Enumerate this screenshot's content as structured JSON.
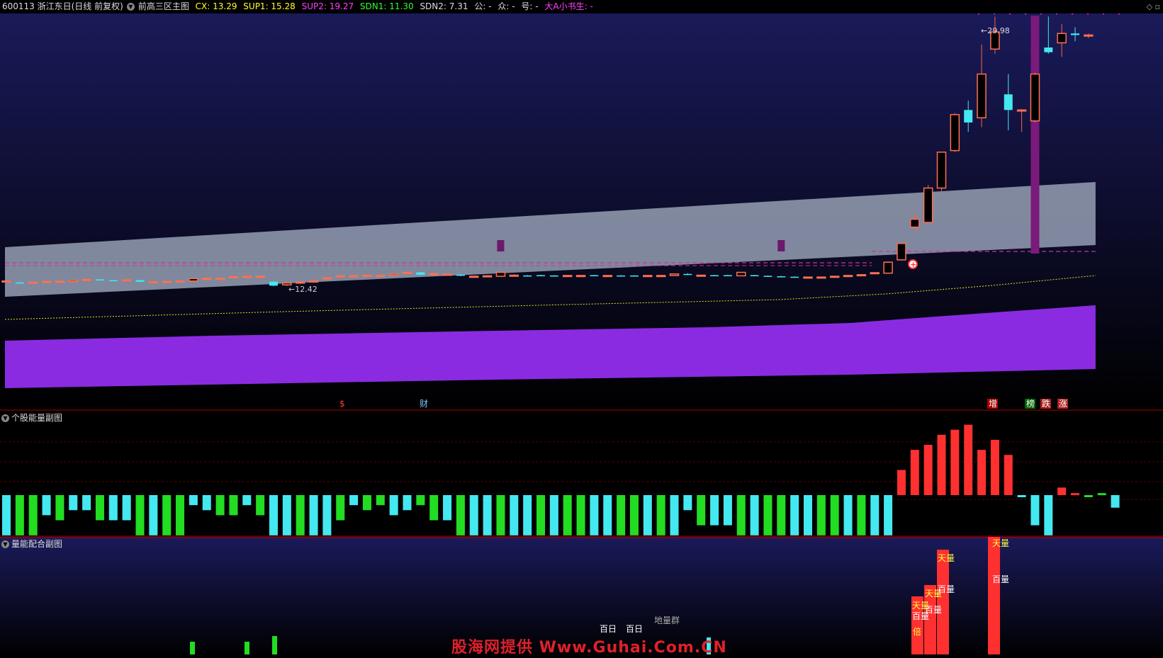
{
  "header": {
    "stock": "600113 浙江东日(日线 前复权)",
    "indicator": "前高三区主图",
    "cx": "CX: 13.29",
    "sup1": "SUP1: 15.28",
    "sup2": "SUP2: 19.27",
    "sdn1": "SDN1: 11.30",
    "sdn2": "SDN2: 7.31",
    "gong": "公: -",
    "zhong": "众: -",
    "hao": "号: -",
    "author": "大A小书生: -"
  },
  "colors": {
    "background": "#000000",
    "main_bg_top": "#1a1a5a",
    "band": "#8a94a8",
    "lower_band": "#8a2be2",
    "up": "#ff3030",
    "down": "#44e8f0",
    "green": "#22dd22",
    "magenta_line": "#cc3399",
    "yellow_dash": "#e8e020"
  },
  "main_panel": {
    "high_label": "29.98",
    "low_label": "←12.42",
    "markers": [
      "$",
      "财",
      "增",
      "榜",
      "跌",
      "涨"
    ]
  },
  "volume_panel": {
    "title": "个股能量副图"
  },
  "mix_panel": {
    "title": "量能配合副图",
    "labels": [
      "天量",
      "百量",
      "天量",
      "百量",
      "天量",
      "百量",
      "天量",
      "百量",
      "地量群",
      "百日",
      "百日",
      "倍"
    ]
  },
  "watermark": "股海网提供 Www.Guhai.Com.CN",
  "chart_data": {
    "type": "candlestick",
    "title": "600113 浙江东日(日线 前复权)",
    "candles": [
      {
        "o": 13.0,
        "c": 13.05,
        "h": 13.1,
        "l": 12.95
      },
      {
        "o": 12.95,
        "c": 12.93,
        "h": 13.0,
        "l": 12.9
      },
      {
        "o": 12.95,
        "c": 12.97,
        "h": 13.0,
        "l": 12.92
      },
      {
        "o": 13.0,
        "c": 13.02,
        "h": 13.05,
        "l": 12.98
      },
      {
        "o": 13.0,
        "c": 13.03,
        "h": 13.05,
        "l": 12.98
      },
      {
        "o": 13.0,
        "c": 13.08,
        "h": 13.1,
        "l": 12.98
      },
      {
        "o": 13.15,
        "c": 13.15,
        "h": 13.2,
        "l": 13.1
      },
      {
        "o": 13.15,
        "c": 13.12,
        "h": 13.18,
        "l": 13.1
      },
      {
        "o": 13.1,
        "c": 13.08,
        "h": 13.12,
        "l": 13.05
      },
      {
        "o": 13.1,
        "c": 13.12,
        "h": 13.15,
        "l": 13.08
      },
      {
        "o": 13.1,
        "c": 13.0,
        "h": 13.12,
        "l": 12.98
      },
      {
        "o": 13.0,
        "c": 13.0,
        "h": 13.02,
        "l": 12.95
      },
      {
        "o": 13.0,
        "c": 13.02,
        "h": 13.05,
        "l": 12.98
      },
      {
        "o": 13.05,
        "c": 13.05,
        "h": 13.07,
        "l": 13.03
      },
      {
        "o": 13.05,
        "c": 13.2,
        "h": 13.25,
        "l": 13.03
      },
      {
        "o": 13.22,
        "c": 13.22,
        "h": 13.3,
        "l": 13.15
      },
      {
        "o": 13.22,
        "c": 13.22,
        "h": 13.28,
        "l": 13.15
      },
      {
        "o": 13.3,
        "c": 13.32,
        "h": 13.38,
        "l": 13.25
      },
      {
        "o": 13.28,
        "c": 13.35,
        "h": 13.45,
        "l": 13.25
      },
      {
        "o": 13.35,
        "c": 13.35,
        "h": 13.4,
        "l": 13.28
      },
      {
        "o": 13.0,
        "c": 12.75,
        "h": 13.05,
        "l": 12.7
      },
      {
        "o": 12.8,
        "c": 12.92,
        "h": 12.95,
        "l": 12.72
      },
      {
        "o": 12.92,
        "c": 12.98,
        "h": 13.02,
        "l": 12.85
      },
      {
        "o": 12.98,
        "c": 13.05,
        "h": 13.1,
        "l": 12.92
      },
      {
        "o": 13.2,
        "c": 13.25,
        "h": 13.3,
        "l": 13.15
      },
      {
        "o": 13.35,
        "c": 13.38,
        "h": 13.42,
        "l": 13.3
      },
      {
        "o": 13.38,
        "c": 13.38,
        "h": 13.45,
        "l": 13.3
      },
      {
        "o": 13.38,
        "c": 13.42,
        "h": 13.45,
        "l": 13.33
      },
      {
        "o": 13.38,
        "c": 13.4,
        "h": 13.43,
        "l": 13.35
      },
      {
        "o": 13.42,
        "c": 13.5,
        "h": 13.53,
        "l": 13.38
      },
      {
        "o": 13.55,
        "c": 13.6,
        "h": 13.62,
        "l": 13.5
      },
      {
        "o": 13.6,
        "c": 13.45,
        "h": 13.63,
        "l": 13.43
      },
      {
        "o": 13.52,
        "c": 13.52,
        "h": 13.58,
        "l": 13.48
      },
      {
        "o": 13.48,
        "c": 13.48,
        "h": 13.5,
        "l": 13.45
      },
      {
        "o": 13.45,
        "c": 13.38,
        "h": 13.48,
        "l": 13.35
      },
      {
        "o": 13.35,
        "c": 13.35,
        "h": 13.4,
        "l": 13.3
      },
      {
        "o": 13.35,
        "c": 13.38,
        "h": 13.42,
        "l": 13.32
      },
      {
        "o": 13.35,
        "c": 13.6,
        "h": 13.62,
        "l": 13.33
      },
      {
        "o": 13.42,
        "c": 13.42,
        "h": 13.48,
        "l": 13.38
      },
      {
        "o": 13.4,
        "c": 13.38,
        "h": 13.43,
        "l": 13.35
      },
      {
        "o": 13.42,
        "c": 13.38,
        "h": 13.45,
        "l": 13.35
      },
      {
        "o": 13.4,
        "c": 13.38,
        "h": 13.43,
        "l": 13.36
      },
      {
        "o": 13.4,
        "c": 13.4,
        "h": 13.42,
        "l": 13.38
      },
      {
        "o": 13.4,
        "c": 13.4,
        "h": 13.42,
        "l": 13.38
      },
      {
        "o": 13.42,
        "c": 13.38,
        "h": 13.44,
        "l": 13.36
      },
      {
        "o": 13.4,
        "c": 13.4,
        "h": 13.42,
        "l": 13.38
      },
      {
        "o": 13.4,
        "c": 13.38,
        "h": 13.42,
        "l": 13.36
      },
      {
        "o": 13.4,
        "c": 13.38,
        "h": 13.42,
        "l": 13.36
      },
      {
        "o": 13.4,
        "c": 13.4,
        "h": 13.42,
        "l": 13.38
      },
      {
        "o": 13.4,
        "c": 13.4,
        "h": 13.42,
        "l": 13.38
      },
      {
        "o": 13.4,
        "c": 13.5,
        "h": 13.52,
        "l": 13.38
      },
      {
        "o": 13.5,
        "c": 13.45,
        "h": 13.55,
        "l": 13.43
      },
      {
        "o": 13.42,
        "c": 13.42,
        "h": 13.44,
        "l": 13.4
      },
      {
        "o": 13.42,
        "c": 13.4,
        "h": 13.44,
        "l": 13.38
      },
      {
        "o": 13.42,
        "c": 13.4,
        "h": 13.44,
        "l": 13.38
      },
      {
        "o": 13.38,
        "c": 13.6,
        "h": 13.62,
        "l": 13.36
      },
      {
        "o": 13.42,
        "c": 13.38,
        "h": 13.44,
        "l": 13.36
      },
      {
        "o": 13.38,
        "c": 13.35,
        "h": 13.4,
        "l": 13.33
      },
      {
        "o": 13.35,
        "c": 13.33,
        "h": 13.38,
        "l": 13.3
      },
      {
        "o": 13.32,
        "c": 13.3,
        "h": 13.35,
        "l": 13.28
      },
      {
        "o": 13.3,
        "c": 13.3,
        "h": 13.32,
        "l": 13.28
      },
      {
        "o": 13.3,
        "c": 13.3,
        "h": 13.32,
        "l": 13.28
      },
      {
        "o": 13.3,
        "c": 13.35,
        "h": 13.38,
        "l": 13.28
      },
      {
        "o": 13.38,
        "c": 13.4,
        "h": 13.45,
        "l": 13.35
      },
      {
        "o": 13.4,
        "c": 13.45,
        "h": 13.5,
        "l": 13.35
      },
      {
        "o": 13.55,
        "c": 13.58,
        "h": 13.6,
        "l": 13.5
      },
      {
        "o": 13.55,
        "c": 14.25,
        "h": 14.3,
        "l": 13.55
      },
      {
        "o": 14.4,
        "c": 15.45,
        "h": 15.5,
        "l": 14.35
      },
      {
        "o": 16.5,
        "c": 17.0,
        "h": 17.5,
        "l": 16.2
      },
      {
        "o": 16.8,
        "c": 19.0,
        "h": 19.2,
        "l": 16.8
      },
      {
        "o": 19.0,
        "c": 21.3,
        "h": 21.3,
        "l": 18.8
      },
      {
        "o": 21.4,
        "c": 23.7,
        "h": 23.8,
        "l": 21.3
      },
      {
        "o": 24.0,
        "c": 23.2,
        "h": 24.6,
        "l": 22.6
      },
      {
        "o": 23.5,
        "c": 26.3,
        "h": 28.2,
        "l": 22.9
      },
      {
        "o": 27.9,
        "c": 29.0,
        "h": 29.98,
        "l": 27.6
      },
      {
        "o": 25.0,
        "c": 24.0,
        "h": 26.3,
        "l": 22.7
      },
      {
        "o": 24.0,
        "c": 24.0,
        "h": 24.05,
        "l": 22.6
      },
      {
        "o": 23.3,
        "c": 26.3,
        "h": 26.4,
        "l": 23.2
      },
      {
        "o": 28.0,
        "c": 27.7,
        "h": 29.98,
        "l": 27.6
      },
      {
        "o": 28.3,
        "c": 28.9,
        "h": 29.5,
        "l": 27.4
      },
      {
        "o": 28.9,
        "c": 28.8,
        "h": 29.3,
        "l": 28.4
      },
      {
        "o": 28.8,
        "c": 28.8,
        "h": 28.9,
        "l": 28.6
      }
    ],
    "volume_energy": [
      -8,
      -8,
      -8,
      -4,
      -5,
      -3,
      -3,
      -5,
      -5,
      -5,
      -8,
      -8,
      -8,
      -8,
      -2,
      -3,
      -4,
      -4,
      -2,
      -4,
      -8,
      -8,
      -8,
      -8,
      -8,
      -5,
      -2,
      -3,
      -2,
      -4,
      -3,
      -2,
      -5,
      -5,
      -8,
      -8,
      -8,
      -8,
      -8,
      -8,
      -8,
      -8,
      -8,
      -8,
      -8,
      -8,
      -8,
      -8,
      -8,
      -8,
      -8,
      -3,
      -6,
      -6,
      -6,
      -8,
      -8,
      -8,
      -8,
      -8,
      -8,
      -8,
      -8,
      -8,
      -8,
      -8,
      -8,
      5,
      9,
      10,
      12,
      13,
      14,
      9,
      11,
      8,
      0,
      -6,
      -8,
      1.5,
      0.4,
      -0.4,
      0.4,
      -2.5
    ],
    "ylim": [
      7,
      31
    ]
  }
}
